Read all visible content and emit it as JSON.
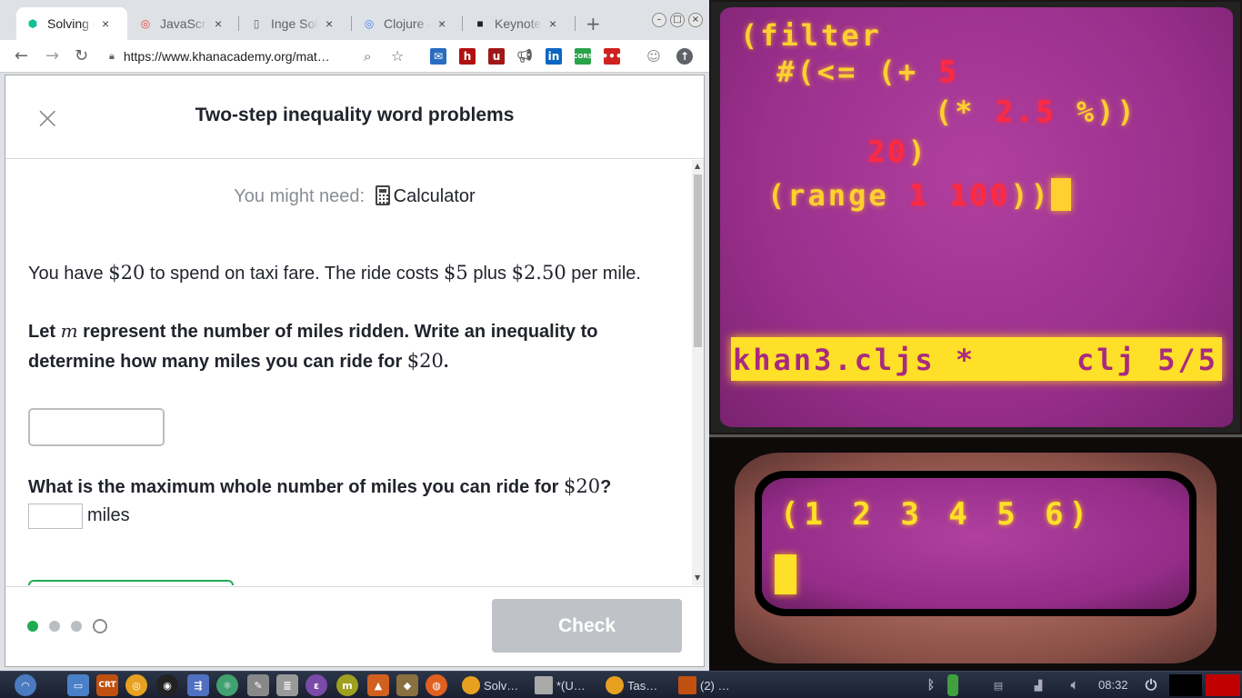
{
  "browser": {
    "tabs": [
      {
        "title": "Solving e",
        "icon": "khan-academy-icon",
        "color": "#14bf96",
        "active": true
      },
      {
        "title": "JavaScri",
        "icon": "chrome-icon",
        "color": "#e94235",
        "active": false
      },
      {
        "title": "Inge Solv",
        "icon": "document-icon",
        "color": "#5f6368",
        "active": false
      },
      {
        "title": "Clojure -",
        "icon": "chrome-icon",
        "color": "#4285f4",
        "active": false
      },
      {
        "title": "Keynote",
        "icon": "keynote-icon",
        "color": "#202124",
        "active": false
      }
    ],
    "close_glyph": "×",
    "new_tab": "+",
    "url": "https://www.khanacademy.org/mat…"
  },
  "dialog": {
    "title": "Two-step inequality word problems",
    "close_glyph": "×",
    "might_need_label": "You might need:",
    "tool_label": "Calculator",
    "problem": {
      "p1_a": "You have ",
      "p1_m1": "$20",
      "p1_b": " to spend on taxi fare. The ride costs ",
      "p1_m2": "$5",
      "p1_c": " plus ",
      "p1_m3": "$2.50",
      "p1_d": " per mile.",
      "q1_a": "Let ",
      "q1_var": "m",
      "q1_b": " represent the number of miles ridden. Write an inequality to",
      "q1_c": "determine how many miles you can ride for ",
      "q1_m": "$20",
      "q1_d": ".",
      "q2_a": "What is the maximum whole number of miles you can ride for ",
      "q2_m": "$20",
      "q2_b": "?",
      "unit": "miles"
    },
    "progress": {
      "current": 1,
      "total": 4
    },
    "check_label": "Check",
    "accent": "#1fab54"
  },
  "crt": {
    "code_lines": [
      {
        "t1": "(filter",
        "n1": ""
      },
      {
        "t1": " #(<= (+ ",
        "n1": "5"
      },
      {
        "t1": "(* ",
        "n1": "2.5",
        "t2": " %))"
      },
      {
        "t1": "",
        "n1": "20",
        "t2": ")"
      },
      {
        "t1": "(range ",
        "n1": "1 100",
        "t2": "))"
      }
    ],
    "modeline_left": "khan3.cljs *",
    "modeline_right": "clj 5/5",
    "repl_output": "(1 2 3 4 5 6)"
  },
  "taskbar": {
    "tasks": [
      "Solv…",
      "*(U…",
      "Tas…",
      "(2) …"
    ],
    "crt_label": "CRT",
    "clock": "08:32"
  }
}
